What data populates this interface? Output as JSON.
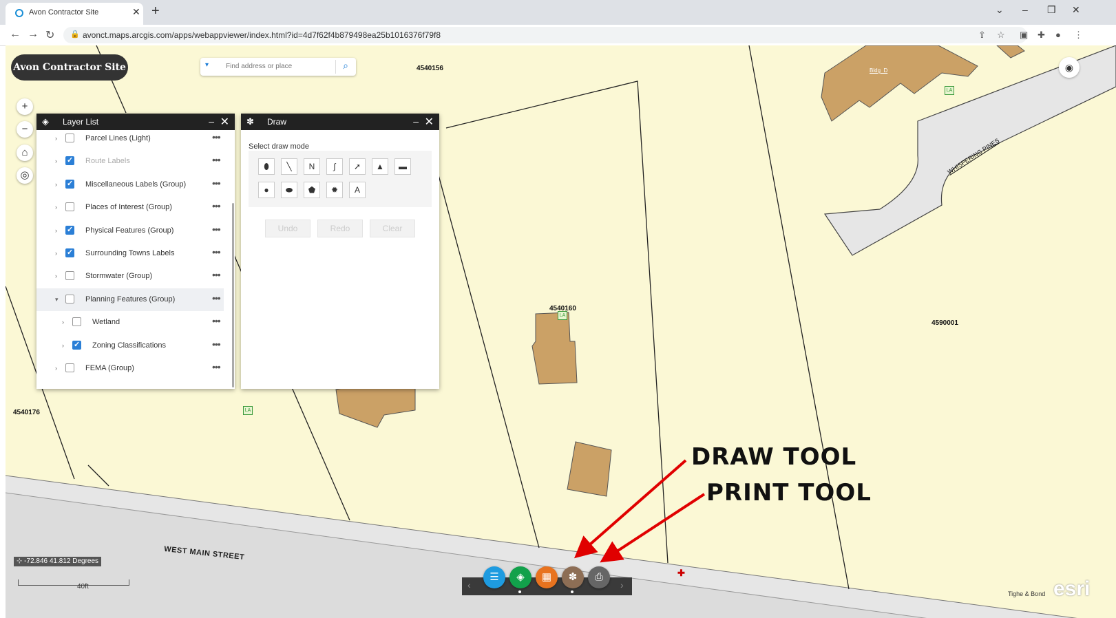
{
  "browser": {
    "tab_title": "Avon Contractor Site",
    "url": "avonct.maps.arcgis.com/apps/webappviewer/index.html?id=4d7f62f4b879498ea25b1016376f79f8"
  },
  "app": {
    "site_title": "Avon Contractor Site",
    "search_placeholder": "Find address or place"
  },
  "parcels": [
    "4540156",
    "4540160",
    "4590001",
    "4540176"
  ],
  "building_label": "Bldg_D",
  "street_labels": {
    "main": "WEST MAIN STREET",
    "side": "WHISPERING PINES"
  },
  "la_label": "LA",
  "layer_list": {
    "title": "Layer List",
    "items": [
      {
        "label": "Parcel Lines (Light)",
        "checked": false,
        "dim": false,
        "indent": 0
      },
      {
        "label": "Route Labels",
        "checked": true,
        "dim": true,
        "indent": 0
      },
      {
        "label": "Miscellaneous Labels (Group)",
        "checked": true,
        "dim": false,
        "indent": 0
      },
      {
        "label": "Places of Interest (Group)",
        "checked": false,
        "dim": false,
        "indent": 0
      },
      {
        "label": "Physical Features (Group)",
        "checked": true,
        "dim": false,
        "indent": 0
      },
      {
        "label": "Surrounding Towns Labels",
        "checked": true,
        "dim": false,
        "indent": 0
      },
      {
        "label": "Stormwater (Group)",
        "checked": false,
        "dim": false,
        "indent": 0
      },
      {
        "label": "Planning Features (Group)",
        "checked": false,
        "dim": false,
        "indent": 0,
        "expanded": true
      },
      {
        "label": "Wetland",
        "checked": false,
        "dim": false,
        "indent": 1
      },
      {
        "label": "Zoning Classifications",
        "checked": true,
        "dim": false,
        "indent": 1
      },
      {
        "label": "FEMA (Group)",
        "checked": false,
        "dim": false,
        "indent": 0
      }
    ]
  },
  "draw": {
    "title": "Draw",
    "mode_label": "Select draw mode",
    "tools": [
      "point",
      "line",
      "polyline",
      "freehand-polyline",
      "arrow",
      "triangle",
      "rectangle",
      "circle",
      "ellipse",
      "polygon",
      "freehand-polygon",
      "text"
    ],
    "undo": "Undo",
    "redo": "Redo",
    "clear": "Clear"
  },
  "coordinates": "-72.846 41.812 Degrees",
  "scale_label": "40ft",
  "annotations": {
    "draw_tool": "DRAW TOOL",
    "print_tool": "PRINT TOOL"
  },
  "credits": "Tighe & Bond",
  "esri_logo": "esri",
  "colors": {
    "map_bg": "#fbf8d5",
    "building": "#cba166",
    "road": "#e6e6e6",
    "arrow": "#e00000",
    "widget_list": "#1e9be0",
    "widget_layers": "#12a14b",
    "widget_grid": "#e8731f",
    "widget_draw": "#8d6e55",
    "widget_print": "#666666"
  }
}
